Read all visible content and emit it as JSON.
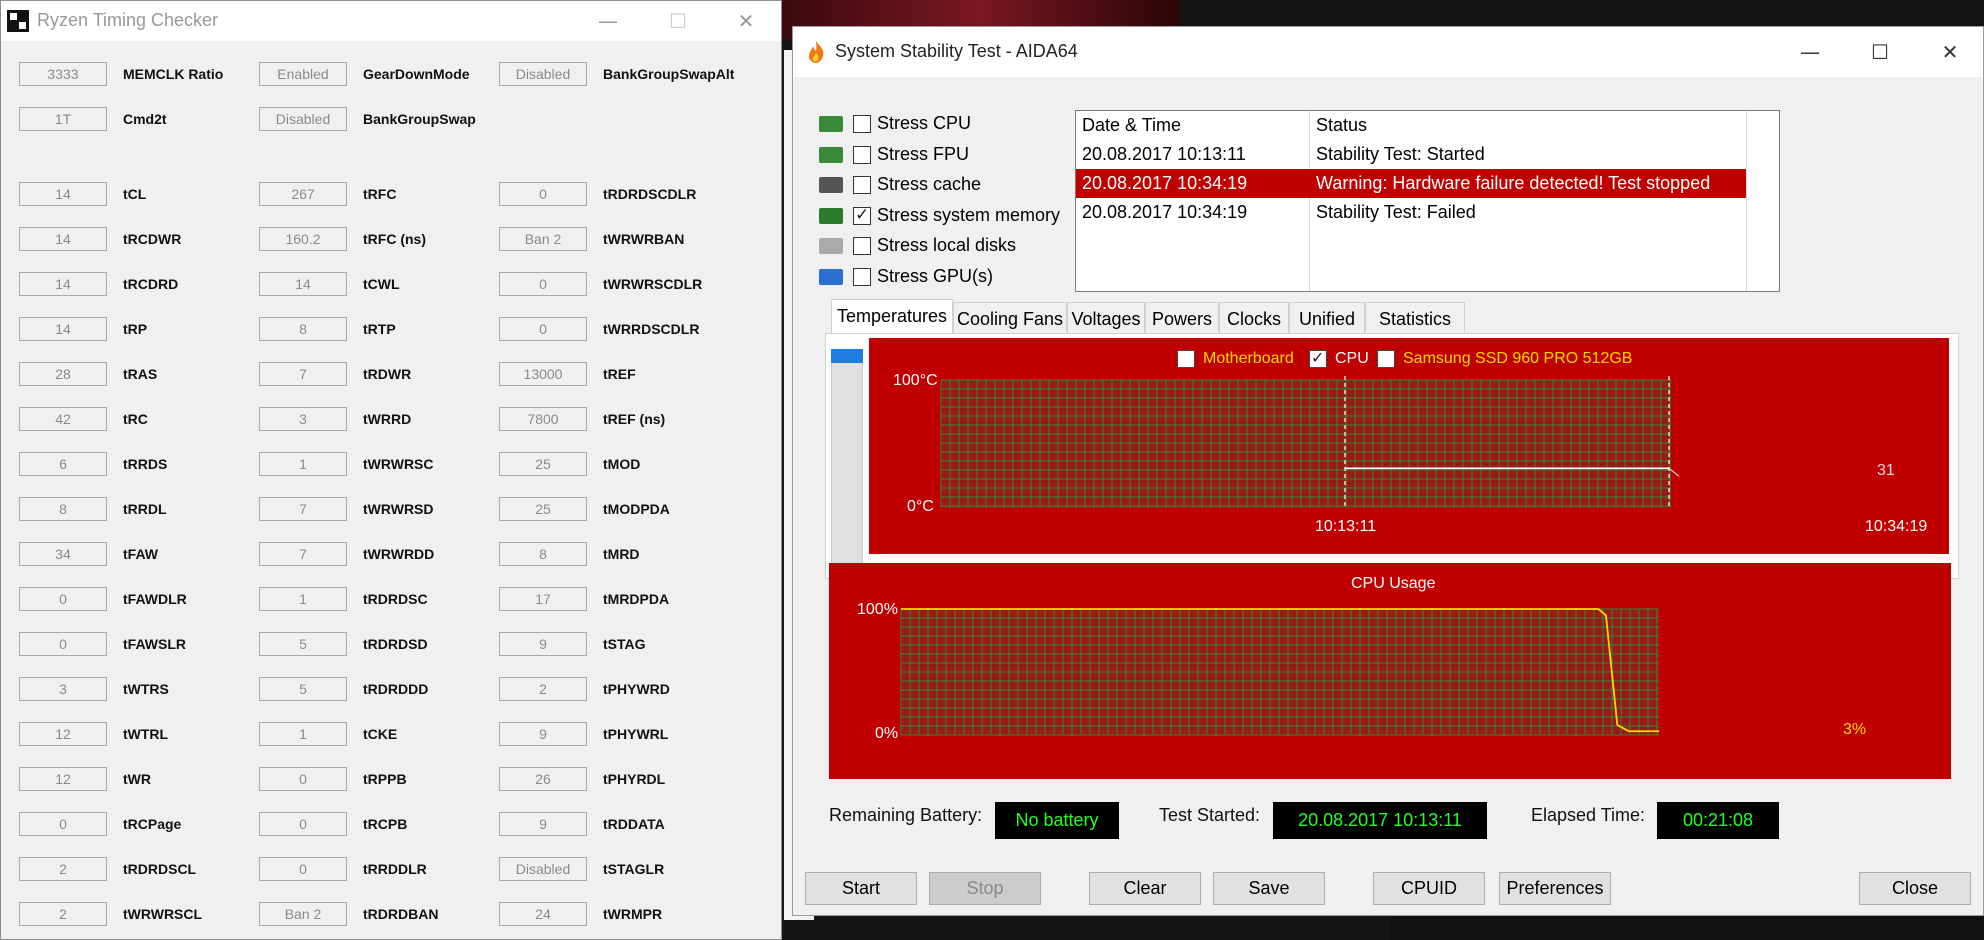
{
  "rtc": {
    "title": "Ryzen Timing Checker",
    "window_controls": {
      "minimize": "—",
      "maximize": "☐",
      "close": "✕"
    },
    "header_rows": [
      [
        {
          "value": "3333",
          "label": "MEMCLK Ratio"
        },
        {
          "value": "Enabled",
          "label": "GearDownMode"
        },
        {
          "value": "Disabled",
          "label": "BankGroupSwapAlt"
        }
      ],
      [
        {
          "value": "1T",
          "label": "Cmd2t"
        },
        {
          "value": "Disabled",
          "label": "BankGroupSwap"
        }
      ]
    ],
    "timing_rows": [
      [
        {
          "value": "14",
          "label": "tCL"
        },
        {
          "value": "267",
          "label": "tRFC"
        },
        {
          "value": "0",
          "label": "tRDRDSCDLR"
        }
      ],
      [
        {
          "value": "14",
          "label": "tRCDWR"
        },
        {
          "value": "160.2",
          "label": "tRFC (ns)"
        },
        {
          "value": "Ban 2",
          "label": "tWRWRBAN"
        }
      ],
      [
        {
          "value": "14",
          "label": "tRCDRD"
        },
        {
          "value": "14",
          "label": "tCWL"
        },
        {
          "value": "0",
          "label": "tWRWRSCDLR"
        }
      ],
      [
        {
          "value": "14",
          "label": "tRP"
        },
        {
          "value": "8",
          "label": "tRTP"
        },
        {
          "value": "0",
          "label": "tWRRDSCDLR"
        }
      ],
      [
        {
          "value": "28",
          "label": "tRAS"
        },
        {
          "value": "7",
          "label": "tRDWR"
        },
        {
          "value": "13000",
          "label": "tREF"
        }
      ],
      [
        {
          "value": "42",
          "label": "tRC"
        },
        {
          "value": "3",
          "label": "tWRRD"
        },
        {
          "value": "7800",
          "label": "tREF (ns)"
        }
      ],
      [
        {
          "value": "6",
          "label": "tRRDS"
        },
        {
          "value": "1",
          "label": "tWRWRSC"
        },
        {
          "value": "25",
          "label": "tMOD"
        }
      ],
      [
        {
          "value": "8",
          "label": "tRRDL"
        },
        {
          "value": "7",
          "label": "tWRWRSD"
        },
        {
          "value": "25",
          "label": "tMODPDA"
        }
      ],
      [
        {
          "value": "34",
          "label": "tFAW"
        },
        {
          "value": "7",
          "label": "tWRWRDD"
        },
        {
          "value": "8",
          "label": "tMRD"
        }
      ],
      [
        {
          "value": "0",
          "label": "tFAWDLR"
        },
        {
          "value": "1",
          "label": "tRDRDSC"
        },
        {
          "value": "17",
          "label": "tMRDPDA"
        }
      ],
      [
        {
          "value": "0",
          "label": "tFAWSLR"
        },
        {
          "value": "5",
          "label": "tRDRDSD"
        },
        {
          "value": "9",
          "label": "tSTAG"
        }
      ],
      [
        {
          "value": "3",
          "label": "tWTRS"
        },
        {
          "value": "5",
          "label": "tRDRDDD"
        },
        {
          "value": "2",
          "label": "tPHYWRD"
        }
      ],
      [
        {
          "value": "12",
          "label": "tWTRL"
        },
        {
          "value": "1",
          "label": "tCKE"
        },
        {
          "value": "9",
          "label": "tPHYWRL"
        }
      ],
      [
        {
          "value": "12",
          "label": "tWR"
        },
        {
          "value": "0",
          "label": "tRPPB"
        },
        {
          "value": "26",
          "label": "tPHYRDL"
        }
      ],
      [
        {
          "value": "0",
          "label": "tRCPage"
        },
        {
          "value": "0",
          "label": "tRCPB"
        },
        {
          "value": "9",
          "label": "tRDDATA"
        }
      ],
      [
        {
          "value": "2",
          "label": "tRDRDSCL"
        },
        {
          "value": "0",
          "label": "tRRDDLR"
        },
        {
          "value": "Disabled",
          "label": "tSTAGLR"
        }
      ],
      [
        {
          "value": "2",
          "label": "tWRWRSCL"
        },
        {
          "value": "Ban 2",
          "label": "tRDRDBAN"
        },
        {
          "value": "24",
          "label": "tWRMPR"
        }
      ]
    ]
  },
  "aida": {
    "title": "System Stability Test - AIDA64",
    "window_controls": {
      "minimize": "—",
      "maximize": "☐",
      "close": "✕"
    },
    "stress_options": [
      {
        "label": "Stress CPU",
        "checked": false,
        "icon": "cpu-chip-icon"
      },
      {
        "label": "Stress FPU",
        "checked": false,
        "icon": "fpu-123-icon"
      },
      {
        "label": "Stress cache",
        "checked": false,
        "icon": "cache-chip-icon"
      },
      {
        "label": "Stress system memory",
        "checked": true,
        "icon": "memory-module-icon"
      },
      {
        "label": "Stress local disks",
        "checked": false,
        "icon": "hard-disk-icon"
      },
      {
        "label": "Stress GPU(s)",
        "checked": false,
        "icon": "gpu-monitor-icon"
      }
    ],
    "log": {
      "headers": [
        "Date & Time",
        "Status"
      ],
      "rows": [
        {
          "time": "20.08.2017 10:13:11",
          "status": "Stability Test: Started",
          "highlight": false
        },
        {
          "time": "20.08.2017 10:34:19",
          "status": "Warning: Hardware failure detected! Test stopped",
          "highlight": true
        },
        {
          "time": "20.08.2017 10:34:19",
          "status": "Stability Test: Failed",
          "highlight": false
        }
      ]
    },
    "tabs": [
      "Temperatures",
      "Cooling Fans",
      "Voltages",
      "Powers",
      "Clocks",
      "Unified",
      "Statistics"
    ],
    "active_tab": "Temperatures",
    "temp_legend": [
      {
        "label": "Motherboard",
        "checked": false,
        "color": "#ffd700"
      },
      {
        "label": "CPU",
        "checked": true,
        "color": "#ffffff"
      },
      {
        "label": "Samsung SSD 960 PRO 512GB",
        "checked": false,
        "color": "#ffd700"
      }
    ],
    "statusbar": {
      "battery_label": "Remaining Battery:",
      "battery_value": "No battery",
      "started_label": "Test Started:",
      "started_value": "20.08.2017 10:13:11",
      "elapsed_label": "Elapsed Time:",
      "elapsed_value": "00:21:08"
    },
    "buttons": {
      "start": "Start",
      "stop": "Stop",
      "clear": "Clear",
      "save": "Save",
      "cpuid": "CPUID",
      "preferences": "Preferences",
      "close": "Close"
    }
  },
  "chart_data": [
    {
      "type": "line",
      "ylim": [
        0,
        100
      ],
      "yticks": [
        "100°C",
        "0°C"
      ],
      "xticks": [
        "10:13:11",
        "10:34:19"
      ],
      "series": [
        {
          "name": "CPU",
          "color": "#ffffff",
          "x": [
            "10:13:11",
            "10:34:19"
          ],
          "values": [
            31,
            31
          ]
        }
      ],
      "end_label": "31",
      "grid": true
    },
    {
      "type": "line",
      "title": "CPU Usage",
      "ylim": [
        0,
        100
      ],
      "yticks": [
        "100%",
        "0%"
      ],
      "series": [
        {
          "color": "#ffd700",
          "x": [
            0,
            0.92,
            0.93,
            0.945,
            0.96,
            1.0
          ],
          "values": [
            100,
            100,
            95,
            8,
            3,
            3
          ]
        }
      ],
      "end_label": "3%",
      "grid": true
    }
  ]
}
